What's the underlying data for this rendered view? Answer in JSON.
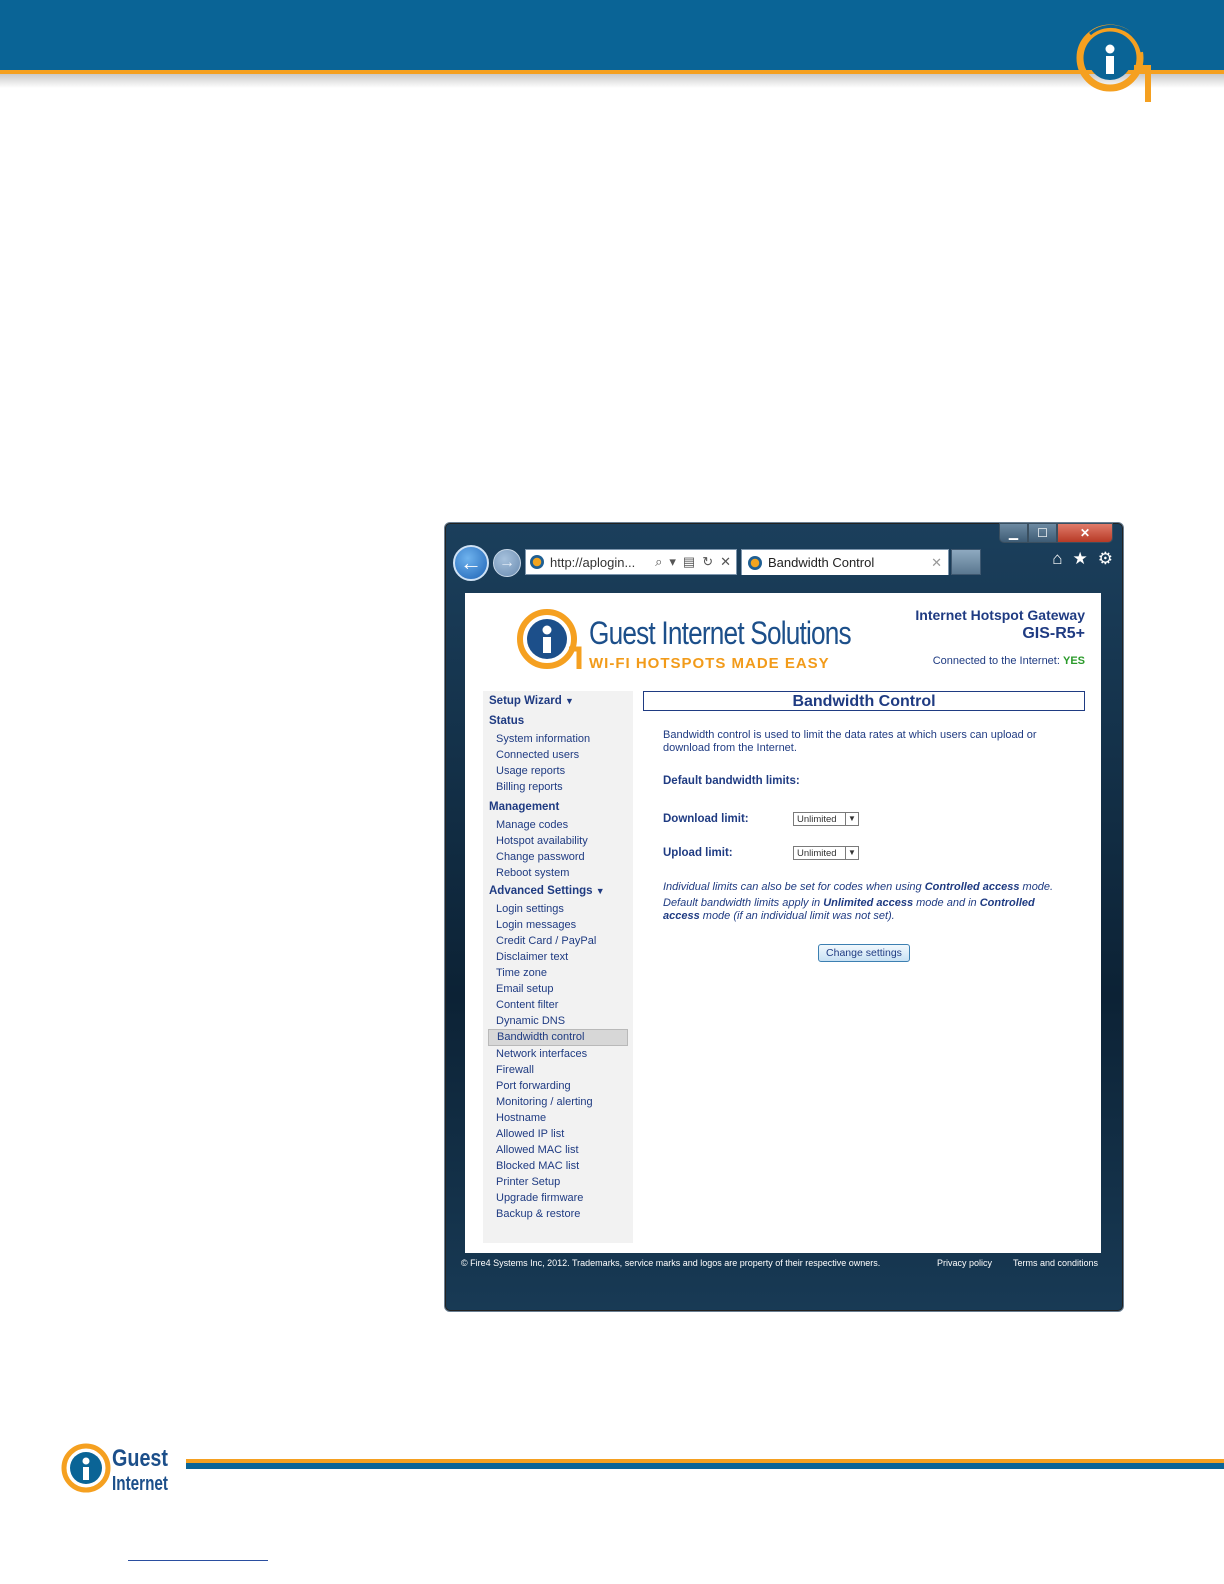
{
  "browser": {
    "address_url": "http://aplogin...",
    "tab_title": "Bandwidth Control"
  },
  "site": {
    "brand_name": "Guest Internet Solutions",
    "tagline": "WI-FI HOTSPOTS MADE EASY",
    "gateway_title": "Internet Hotspot Gateway",
    "gateway_model": "GIS-R5+",
    "connection_label": "Connected to the Internet:",
    "connection_value": "YES"
  },
  "sidebar": {
    "setup_wizard": "Setup Wizard",
    "status": "Status",
    "status_items": [
      "System information",
      "Connected users",
      "Usage reports",
      "Billing reports"
    ],
    "management": "Management",
    "management_items": [
      "Manage codes",
      "Hotspot availability",
      "Change password",
      "Reboot system"
    ],
    "advanced": "Advanced Settings",
    "advanced_items": [
      "Login settings",
      "Login messages",
      "Credit Card / PayPal",
      "Disclaimer text",
      "Time zone",
      "Email setup",
      "Content filter",
      "Dynamic DNS",
      "Bandwidth control",
      "Network interfaces",
      "Firewall",
      "Port forwarding",
      "Monitoring / alerting",
      "Hostname",
      "Allowed IP list",
      "Allowed MAC list",
      "Blocked MAC list",
      "Printer Setup",
      "Upgrade firmware",
      "Backup & restore"
    ]
  },
  "main": {
    "title": "Bandwidth Control",
    "intro": "Bandwidth control is used to limit the data rates at which users can upload or download from the Internet.",
    "default_label": "Default bandwidth limits:",
    "download_label": "Download limit:",
    "download_value": "Unlimited",
    "upload_label": "Upload limit:",
    "upload_value": "Unlimited",
    "note1_a": "Individual limits can also be set for codes when using ",
    "note1_b": "Controlled access",
    "note1_c": " mode.",
    "note2_a": "Default bandwidth limits apply in ",
    "note2_b": "Unlimited access",
    "note2_c": " mode and in ",
    "note2_d": "Controlled access",
    "note2_e": " mode (if an individual limit was not set).",
    "change_button": "Change settings"
  },
  "footer": {
    "copyright": "© Fire4 Systems Inc, 2012. Trademarks, service marks and logos are property of their respective owners.",
    "privacy": "Privacy policy",
    "terms": "Terms and conditions"
  },
  "doc_footer": {
    "logo_line1": "Guest",
    "logo_line2": "Internet"
  },
  "colors": {
    "header_blue": "#0a6496",
    "accent_orange": "#f5a020",
    "nav_text": "#1f3b82",
    "status_ok": "#2a9a2a"
  }
}
